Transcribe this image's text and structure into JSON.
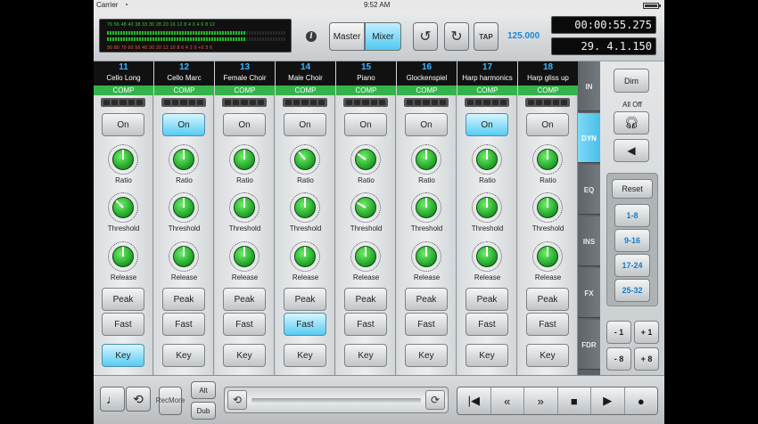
{
  "status": {
    "carrier": "Carrier",
    "time": "9:52 AM"
  },
  "meter": {
    "top_scale": "76  56  48  40  38  33  30  28  20  16  12  8   4   0   4   6   8   12",
    "bottom_scale": "90  80  70  60  50  40  30  20  12  10  8   6   4   2   0   +0  3   6"
  },
  "header": {
    "master_label": "Master",
    "mixer_label": "Mixer",
    "tap_label": "TAP",
    "tempo": "125.000",
    "time_display": "00:00:55.275",
    "position_display": "29. 4.1.150"
  },
  "strips": [
    {
      "num": "11",
      "name": "Cello Long",
      "comp": "COMP",
      "on": "On",
      "ratio": "Ratio",
      "threshold": "Threshold",
      "release": "Release",
      "peak": "Peak",
      "fast": "Fast",
      "key": "Key",
      "on_active": false,
      "fast_active": false,
      "key_active": true,
      "ratio_angle": 0,
      "threshold_angle": -45,
      "release_angle": 0
    },
    {
      "num": "12",
      "name": "Cello Marc",
      "comp": "COMP",
      "on": "On",
      "ratio": "Ratio",
      "threshold": "Threshold",
      "release": "Release",
      "peak": "Peak",
      "fast": "Fast",
      "key": "Key",
      "on_active": true,
      "fast_active": false,
      "key_active": false,
      "ratio_angle": 0,
      "threshold_angle": 0,
      "release_angle": 0
    },
    {
      "num": "13",
      "name": "Female Choir",
      "comp": "COMP",
      "on": "On",
      "ratio": "Ratio",
      "threshold": "Threshold",
      "release": "Release",
      "peak": "Peak",
      "fast": "Fast",
      "key": "Key",
      "on_active": false,
      "fast_active": false,
      "key_active": false,
      "ratio_angle": 0,
      "threshold_angle": 0,
      "release_angle": 0
    },
    {
      "num": "14",
      "name": "Male Choir",
      "comp": "COMP",
      "on": "On",
      "ratio": "Ratio",
      "threshold": "Threshold",
      "release": "Release",
      "peak": "Peak",
      "fast": "Fast",
      "key": "Key",
      "on_active": false,
      "fast_active": true,
      "key_active": false,
      "ratio_angle": -40,
      "threshold_angle": 0,
      "release_angle": 0
    },
    {
      "num": "15",
      "name": "Piano",
      "comp": "COMP",
      "on": "On",
      "ratio": "Ratio",
      "threshold": "Threshold",
      "release": "Release",
      "peak": "Peak",
      "fast": "Fast",
      "key": "Key",
      "on_active": false,
      "fast_active": false,
      "key_active": false,
      "ratio_angle": -55,
      "threshold_angle": -60,
      "release_angle": 0
    },
    {
      "num": "16",
      "name": "Glockenspiel",
      "comp": "COMP",
      "on": "On",
      "ratio": "Ratio",
      "threshold": "Threshold",
      "release": "Release",
      "peak": "Peak",
      "fast": "Fast",
      "key": "Key",
      "on_active": false,
      "fast_active": false,
      "key_active": false,
      "ratio_angle": 0,
      "threshold_angle": 0,
      "release_angle": 0
    },
    {
      "num": "17",
      "name": "Harp harmonics",
      "comp": "COMP",
      "on": "On",
      "ratio": "Ratio",
      "threshold": "Threshold",
      "release": "Release",
      "peak": "Peak",
      "fast": "Fast",
      "key": "Key",
      "on_active": true,
      "fast_active": false,
      "key_active": false,
      "ratio_angle": 0,
      "threshold_angle": 0,
      "release_angle": 0
    },
    {
      "num": "18",
      "name": "Harp gliss up",
      "comp": "COMP",
      "on": "On",
      "ratio": "Ratio",
      "threshold": "Threshold",
      "release": "Release",
      "peak": "Peak",
      "fast": "Fast",
      "key": "Key",
      "on_active": false,
      "fast_active": false,
      "key_active": false,
      "ratio_angle": 0,
      "threshold_angle": 0,
      "release_angle": 0
    }
  ],
  "tabs": [
    {
      "label": "IN",
      "active": false
    },
    {
      "label": "DYN",
      "active": true
    },
    {
      "label": "EQ",
      "active": false
    },
    {
      "label": "INS",
      "active": false
    },
    {
      "label": "FX",
      "active": false
    },
    {
      "label": "FDR",
      "active": false
    }
  ],
  "right_panel": {
    "dim_label": "Dim",
    "all_off_label": "All Off",
    "reset_label": "Reset",
    "banks": [
      "1-8",
      "9-16",
      "17-24",
      "25-32"
    ],
    "minus1": "- 1",
    "plus1": "+ 1",
    "minus8": "- 8",
    "plus8": "+ 8"
  },
  "bottom": {
    "rec_more_line1": "Rec",
    "rec_more_line2": "More",
    "alt_label": "Alt",
    "dub_label": "Dub"
  },
  "colors": {
    "accent_blue": "#52c8f2",
    "comp_green": "#34b34a",
    "knob_green": "#1d9c24",
    "channel_number_blue": "#3fb7ff"
  },
  "icons": {
    "undo": "undo-icon",
    "redo": "redo-icon",
    "headphones": "headphones-icon",
    "speaker": "speaker-icon",
    "metronome": "metronome-icon",
    "cycle": "cycle-icon",
    "rewind_start": "go-to-start-icon",
    "rewind": "rewind-icon",
    "forward": "fast-forward-icon",
    "stop": "stop-icon",
    "play": "play-icon",
    "record": "record-icon"
  }
}
